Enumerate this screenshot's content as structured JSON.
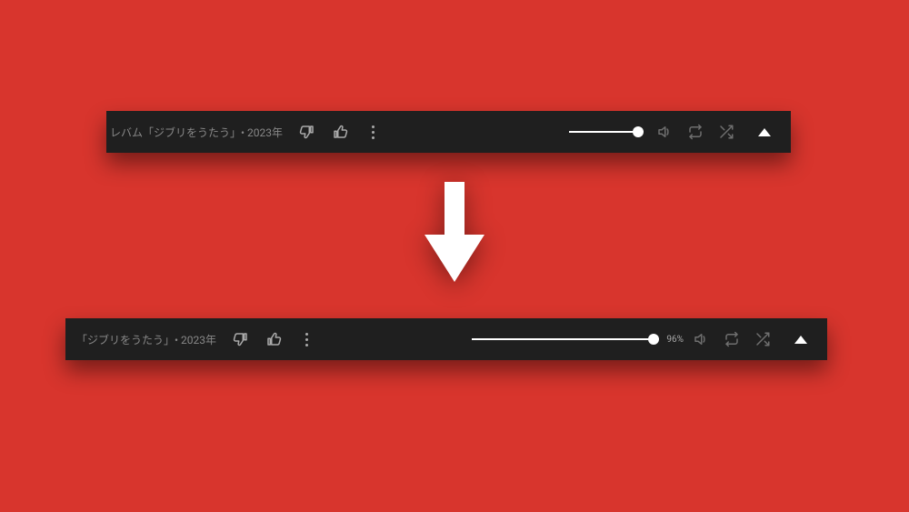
{
  "before": {
    "title": "レバム「ジブリをうたう」• 2023年",
    "volumeTrackPx": 76
  },
  "after": {
    "title": "「ジブリをうたう」• 2023年",
    "volumeTrackPx": 200,
    "volumePercent": "96%"
  },
  "icons": {
    "dislike": "thumbs-down",
    "like": "thumbs-up",
    "more": "more-vert",
    "volume": "speaker",
    "repeat": "repeat",
    "shuffle": "shuffle",
    "expand": "caret-up"
  }
}
